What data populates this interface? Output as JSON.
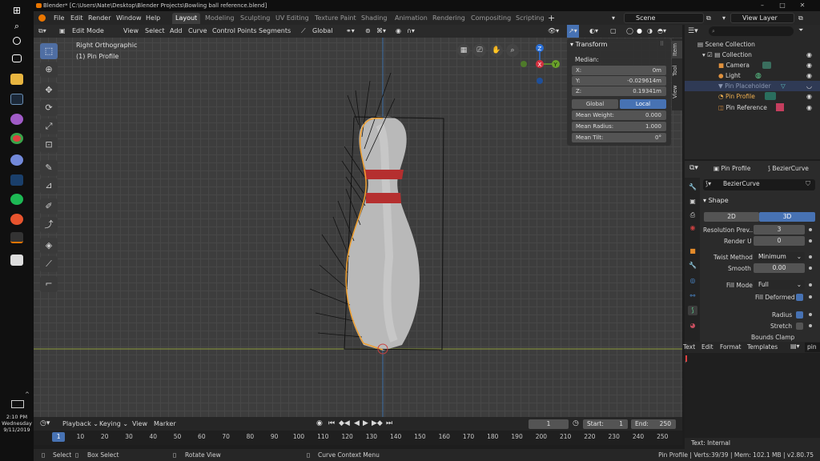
{
  "window": {
    "app": "Blender",
    "title": "Blender* [C:\\Users\\Nate\\Desktop\\Blender Projects\\Bowling ball reference.blend]"
  },
  "taskbar": {
    "time": "2:10 PM",
    "day": "Wednesday",
    "date": "9/11/2019"
  },
  "menus": [
    "File",
    "Edit",
    "Render",
    "Window",
    "Help"
  ],
  "workspaces": [
    "Layout",
    "Modeling",
    "Sculpting",
    "UV Editing",
    "Texture Paint",
    "Shading",
    "Animation",
    "Rendering",
    "Compositing",
    "Scripting"
  ],
  "active_workspace": "Layout",
  "scene": {
    "name": "Scene",
    "view_layer": "View Layer"
  },
  "viewport": {
    "mode": "Edit Mode",
    "menus": [
      "View",
      "Select",
      "Add",
      "Curve",
      "Control Points",
      "Segments"
    ],
    "transform_orientation": "Global",
    "view_name": "Right Orthographic",
    "object_info": "(1) Pin Profile"
  },
  "npanel": {
    "title": "Transform",
    "median_label": "Median:",
    "x_label": "X:",
    "x": "0m",
    "y_label": "Y:",
    "y": "-0.029614m",
    "z_label": "Z:",
    "z": "0.19341m",
    "global": "Global",
    "local": "Local",
    "mean_weight_label": "Mean Weight:",
    "mean_weight": "0.000",
    "mean_radius_label": "Mean Radius:",
    "mean_radius": "1.000",
    "mean_tilt_label": "Mean Tilt:",
    "mean_tilt": "0°",
    "tabs": [
      "Item",
      "Tool",
      "View"
    ]
  },
  "outliner": {
    "root": "Scene Collection",
    "items": [
      {
        "label": "Collection",
        "indent": 1
      },
      {
        "label": "Camera",
        "indent": 2
      },
      {
        "label": "Light",
        "indent": 2
      },
      {
        "label": "Pin Placeholder",
        "indent": 2
      },
      {
        "label": "Pin Profile",
        "indent": 2
      },
      {
        "label": "Pin Reference",
        "indent": 2
      }
    ]
  },
  "properties": {
    "object": "Pin Profile",
    "data": "BezierCurve",
    "data_field": "BezierCurve",
    "section": "Shape",
    "dim_2d": "2D",
    "dim_3d": "3D",
    "resolution_preview_label": "Resolution Prev..",
    "resolution_preview": "3",
    "render_u_label": "Render U",
    "render_u": "0",
    "twist_method_label": "Twist Method",
    "twist_method": "Minimum",
    "smooth_label": "Smooth",
    "smooth": "0.00",
    "fill_mode_label": "Fill Mode",
    "fill_mode": "Full",
    "fill_deformed_label": "Fill Deformed",
    "radius_label": "Radius",
    "stretch_label": "Stretch",
    "bounds_clamp_label": "Bounds Clamp"
  },
  "text_editor": {
    "menus": [
      "Text",
      "Edit",
      "Format",
      "Templates"
    ],
    "name": "pin",
    "status": "Text: Internal"
  },
  "timeline": {
    "menus": [
      "Playback",
      "Keying",
      "View",
      "Marker"
    ],
    "current_frame": "1",
    "start_label": "Start:",
    "start": "1",
    "end_label": "End:",
    "end": "250",
    "frames": [
      "1",
      "10",
      "20",
      "30",
      "40",
      "50",
      "60",
      "70",
      "80",
      "90",
      "100",
      "110",
      "120",
      "130",
      "140",
      "150",
      "160",
      "170",
      "180",
      "190",
      "200",
      "210",
      "220",
      "230",
      "240",
      "250"
    ]
  },
  "statusbar": {
    "select": "Select",
    "box_select": "Box Select",
    "rotate_view": "Rotate View",
    "context_menu": "Curve Context Menu",
    "info": "Pin Profile | Verts:39/39 | Mem: 102.1 MB | v2.80.75"
  }
}
